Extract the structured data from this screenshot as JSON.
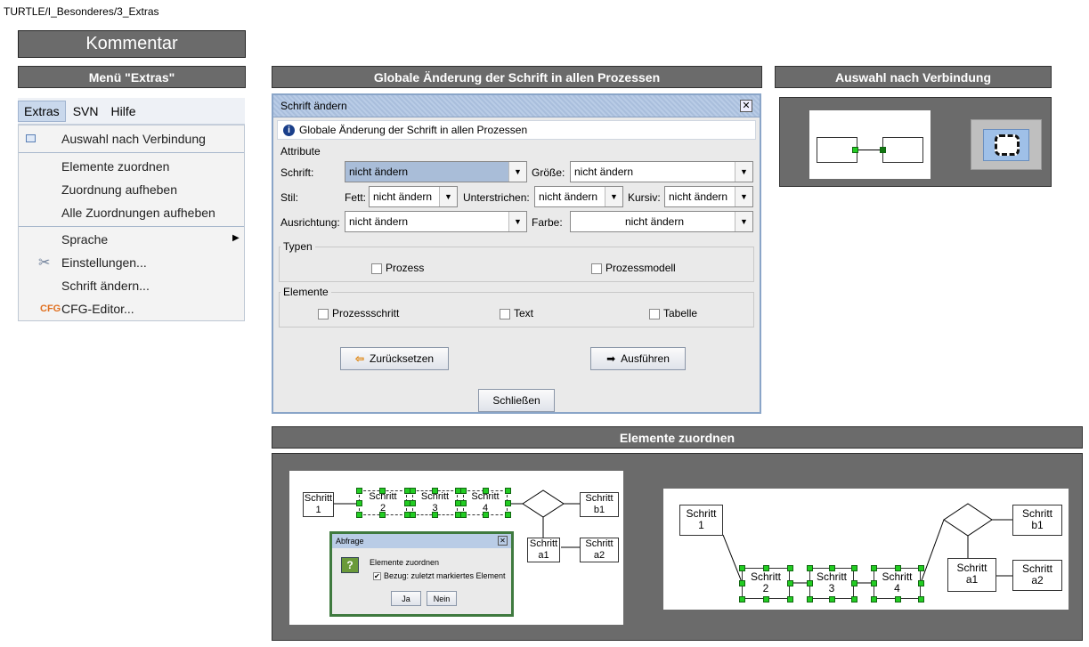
{
  "breadcrumb": "TURTLE/I_Besonderes/3_Extras",
  "comment_label": "Kommentar",
  "sections": {
    "menu": "Menü \"Extras\"",
    "global": "Globale Änderung der Schrift in allen Prozessen",
    "connection": "Auswahl nach Verbindung",
    "assign": "Elemente zuordnen"
  },
  "menubar": [
    "Extras",
    "SVN",
    "Hilfe"
  ],
  "menu_items": {
    "by_connection": "Auswahl nach Verbindung",
    "assign": "Elemente zuordnen",
    "unassign": "Zuordnung aufheben",
    "unassign_all": "Alle Zuordnungen aufheben",
    "language": "Sprache",
    "settings": "Einstellungen...",
    "font": "Schrift ändern...",
    "cfg": "CFG-Editor...",
    "cfg_icon_text": "CFG"
  },
  "dialog": {
    "title": "Schrift ändern",
    "info": "Globale Änderung der Schrift in allen Prozessen",
    "attr_group": "Attribute",
    "font_label": "Schrift:",
    "font_value": "nicht ändern",
    "size_label": "Größe:",
    "size_value": "nicht ändern",
    "style_label": "Stil:",
    "bold_label": "Fett:",
    "bold_value": "nicht ändern",
    "underline_label": "Unterstrichen:",
    "underline_value": "nicht ändern",
    "italic_label": "Kursiv:",
    "italic_value": "nicht ändern",
    "align_label": "Ausrichtung:",
    "align_value": "nicht ändern",
    "color_label": "Farbe:",
    "color_value": "nicht ändern",
    "types_group": "Typen",
    "type_process": "Prozess",
    "type_model": "Prozessmodell",
    "elements_group": "Elemente",
    "el_step": "Prozessschritt",
    "el_text": "Text",
    "el_table": "Tabelle",
    "reset": "Zurücksetzen",
    "execute": "Ausführen",
    "close": "Schließen"
  },
  "diagram": {
    "step1": [
      "Schritt",
      "1"
    ],
    "step2": [
      "Schritt",
      "2"
    ],
    "step3": [
      "Schritt",
      "3"
    ],
    "step4": [
      "Schritt",
      "4"
    ],
    "stepb1": [
      "Schritt",
      "b1"
    ],
    "stepa1": [
      "Schritt",
      "a1"
    ],
    "stepa2": [
      "Schritt",
      "a2"
    ]
  },
  "query": {
    "title": "Abfrage",
    "text": "Elemente zuordnen",
    "checkbox": "Bezug: zuletzt markiertes Element",
    "yes": "Ja",
    "no": "Nein"
  },
  "colors": {
    "header_bg": "#6b6b6b",
    "handle": "#22cc22"
  }
}
